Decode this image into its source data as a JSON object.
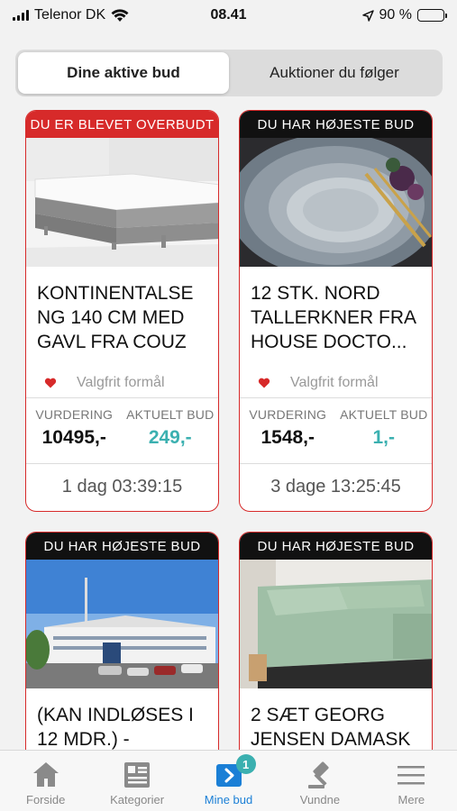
{
  "status": {
    "carrier": "Telenor DK",
    "time": "08.41",
    "battery": "90 %",
    "battery_level": 0.9
  },
  "segments": [
    {
      "label": "Dine aktive bud",
      "active": true
    },
    {
      "label": "Auktioner du følger",
      "active": false
    }
  ],
  "cards": [
    {
      "banner": "DU ER BLEVET OVERBUDT",
      "banner_type": "outbid",
      "image": "boxspring-bed-photo",
      "title": "KONTINENTALSE NG 140 CM MED GAVL FRA COUZ",
      "cause": "Valgfrit formål",
      "estimate_label": "VURDERING",
      "estimate": "10495,-",
      "current_label": "AKTUELT BUD",
      "current": "249,-",
      "timer": "1 dag 03:39:15"
    },
    {
      "banner": "DU HAR HØJESTE BUD",
      "banner_type": "highest",
      "image": "plates-photo",
      "title": "12 STK. NORD TALLERKNER FRA HOUSE DOCTO...",
      "cause": "Valgfrit formål",
      "estimate_label": "VURDERING",
      "estimate": "1548,-",
      "current_label": "AKTUELT BUD",
      "current": "1,-",
      "timer": "3 dage 13:25:45"
    },
    {
      "banner": "DU HAR HØJESTE BUD",
      "banner_type": "highest",
      "image": "hotel-building-photo",
      "title": "(KAN INDLØSES I 12 MDR.) -"
    },
    {
      "banner": "DU HAR HØJESTE BUD",
      "banner_type": "highest",
      "image": "bed-linen-photo",
      "title": "2 SÆT GEORG JENSEN DAMASK"
    }
  ],
  "tabs": [
    {
      "label": "Forside",
      "icon": "home-icon",
      "active": false
    },
    {
      "label": "Kategorier",
      "icon": "categories-icon",
      "active": false
    },
    {
      "label": "Mine bud",
      "icon": "my-bids-icon",
      "active": true,
      "badge": "1"
    },
    {
      "label": "Vundne",
      "icon": "gavel-icon",
      "active": false
    },
    {
      "label": "Mere",
      "icon": "menu-icon",
      "active": false
    }
  ],
  "colors": {
    "accent_red": "#d72a2a",
    "accent_teal": "#3bb0b0",
    "tab_active": "#1a7fd6"
  }
}
